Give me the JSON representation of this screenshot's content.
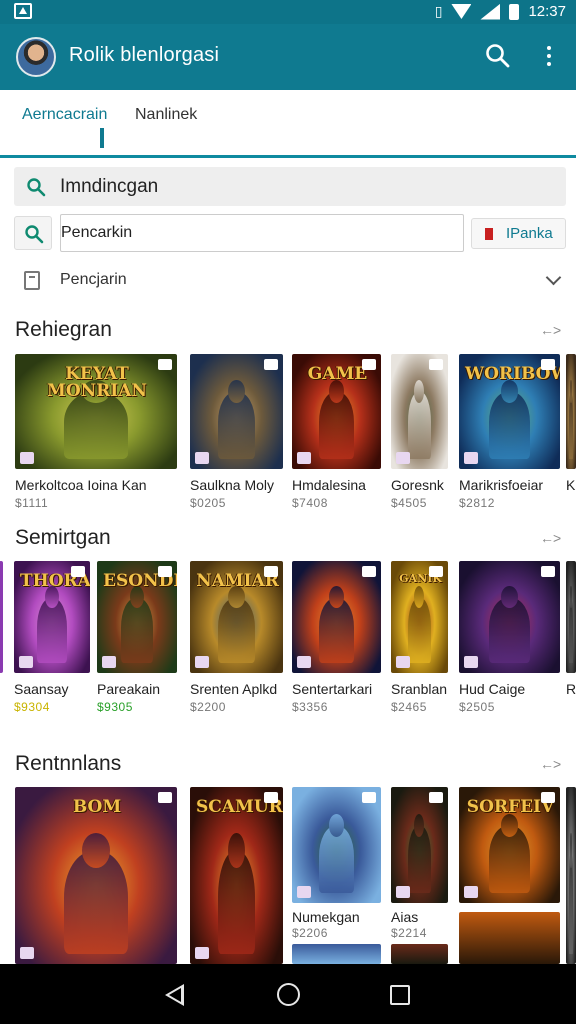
{
  "status_bar": {
    "time": "12:37"
  },
  "app_bar": {
    "title": "Rolik blenlorgasi"
  },
  "tabs": [
    {
      "label": "Aerncacrain",
      "active": true
    },
    {
      "label": "Nanlinek",
      "active": false
    }
  ],
  "search": {
    "main_text": "Imndincgan",
    "input_value": "Pencarkin",
    "filter_label": "IPanka"
  },
  "dropdown": {
    "label": "Pencjarin"
  },
  "sections": [
    {
      "title": "Rehiegran",
      "see_more": "←>",
      "items": [
        {
          "name": "Merkoltcoa Ioina Kan",
          "price": "$1111",
          "art_title": "KEYAT MONRIAN",
          "colors": [
            "#2c3b12",
            "#8a9a2e",
            "#d7d05a"
          ]
        },
        {
          "name": "Saulkna Moly",
          "price": "$0205",
          "art_title": "",
          "colors": [
            "#1d2f4e",
            "#6d5a3c",
            "#c9a36a"
          ]
        },
        {
          "name": "Hmdalesina",
          "price": "$7408",
          "art_title": "GAME",
          "colors": [
            "#3a0b05",
            "#b5301a",
            "#f09a2a"
          ]
        },
        {
          "name": "Goresnk",
          "price": "$4505",
          "art_title": "",
          "colors": [
            "#e8e4de",
            "#8d7a62",
            "#3f5c3a"
          ]
        },
        {
          "name": "Marikrisfoeiar",
          "price": "$2812",
          "art_title": "WORIBOW",
          "colors": [
            "#0f2c58",
            "#2f7fb5",
            "#6fb56a"
          ]
        },
        {
          "name": "K",
          "price": "",
          "art_title": "",
          "colors": [
            "#3a2a1a",
            "#8d6d3c",
            "#c09a5a"
          ]
        }
      ]
    },
    {
      "title": "Semirtgan",
      "see_more": "←>",
      "items": [
        {
          "name": "Saansay",
          "price": "$9304",
          "price_style": "yellow",
          "art_title": "THORANKER",
          "colors": [
            "#3d1250",
            "#b24cc0",
            "#e090d8"
          ]
        },
        {
          "name": "Pareakain",
          "price": "$9305",
          "price_style": "green",
          "art_title": "ESONDR",
          "colors": [
            "#1e3a18",
            "#7a3a1a",
            "#d8a04a"
          ]
        },
        {
          "name": "Srenten Aplkd",
          "price": "$2200",
          "art_title": "NAMIAR",
          "colors": [
            "#4a3410",
            "#b88a2a",
            "#2a5a8c"
          ]
        },
        {
          "name": "Sentertarkari",
          "price": "$3356",
          "art_title": "",
          "colors": [
            "#101438",
            "#c0401a",
            "#f09030"
          ]
        },
        {
          "name": "Sranblan",
          "price": "$2465",
          "art_title": "GANIK",
          "colors": [
            "#6a4a08",
            "#e0b020",
            "#8a2a1a"
          ]
        },
        {
          "name": "Hud Caige",
          "price": "$2505",
          "art_title": "",
          "colors": [
            "#1a1030",
            "#5a2a7a",
            "#c03050"
          ]
        },
        {
          "name": "R",
          "price": "",
          "art_title": "",
          "colors": [
            "#222",
            "#555",
            "#999"
          ]
        }
      ]
    },
    {
      "title": "Rentnnlans",
      "see_more": "←>",
      "items": [
        {
          "name": "",
          "price": "",
          "art_title": "BOM",
          "colors": [
            "#3a1a40",
            "#c04020",
            "#f0b030"
          ]
        },
        {
          "name": "",
          "price": "",
          "art_title": "SCAMUR",
          "colors": [
            "#2a0e08",
            "#a02818",
            "#f0a030"
          ]
        },
        {
          "name": "Numekgan",
          "price": "$2206",
          "art_title": "",
          "colors": [
            "#7ab0e0",
            "#3a5a9a",
            "#2a6a2a"
          ]
        },
        {
          "name": "Aias",
          "price": "$2214",
          "art_title": "",
          "colors": [
            "#1a1a10",
            "#6a2a1a",
            "#3a7a3a"
          ]
        },
        {
          "name": "",
          "price": "",
          "art_title": "SORFEIV",
          "colors": [
            "#2a1808",
            "#c05a10",
            "#e0a030"
          ]
        },
        {
          "name": "",
          "price": "",
          "art_title": "",
          "colors": [
            "#222",
            "#666",
            "#aaa"
          ]
        }
      ]
    }
  ]
}
